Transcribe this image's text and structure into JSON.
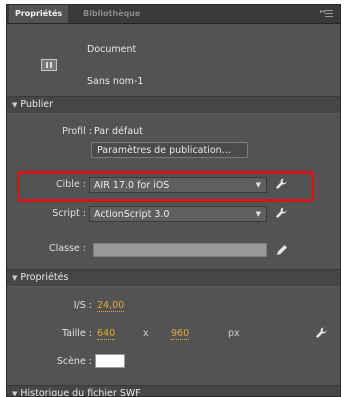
{
  "tabs": [
    {
      "label": "Propriétés"
    },
    {
      "label": "Bibliothèque"
    }
  ],
  "document": {
    "type_label": "Document",
    "name": "Sans nom-1"
  },
  "sections": {
    "publish": "Publier",
    "properties": "Propriétés",
    "swf_history": "Historique du fichier SWF"
  },
  "publish": {
    "profile_label": "Profil :",
    "profile_value": "Par défaut",
    "settings_button": "Paramètres de publication...",
    "target_label": "Cible :",
    "target_value": "AIR 17.0 for iOS",
    "script_label": "Script :",
    "script_value": "ActionScript 3.0",
    "class_label": "Classe :"
  },
  "properties": {
    "fps_label": "I/S :",
    "fps_value": "24,00",
    "size_label": "Taille :",
    "width": "640",
    "times": "x",
    "height": "960",
    "unit": "px",
    "stage_label": "Scène :",
    "stage_color": "#ffffff"
  },
  "highlight_color": "#d4141e"
}
